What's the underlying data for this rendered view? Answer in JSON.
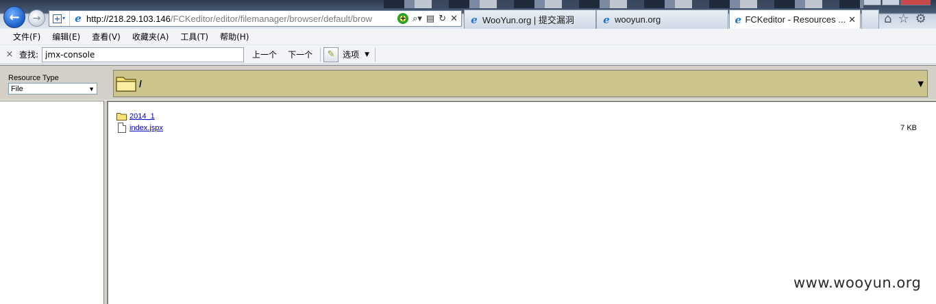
{
  "browser": {
    "url_host": "http://218.29.103.146",
    "url_path": "/FCKeditor/editor/filemanager/browser/default/brow",
    "tabs": [
      {
        "title": "WooYun.org | 提交漏洞",
        "icon": "ie-icon"
      },
      {
        "title": "wooyun.org",
        "icon": "ie-icon"
      },
      {
        "title": "FCKeditor - Resources ...",
        "icon": "ie-icon",
        "active": true
      }
    ]
  },
  "menu": [
    "文件(F)",
    "编辑(E)",
    "查看(V)",
    "收藏夹(A)",
    "工具(T)",
    "帮助(H)"
  ],
  "find": {
    "close": "×",
    "label": "查找:",
    "value": "jmx-console",
    "prev": "上一个",
    "next": "下一个",
    "options": "选项"
  },
  "fck": {
    "resource_type_label": "Resource Type",
    "resource_type_value": "File",
    "current_folder": "/",
    "items": [
      {
        "type": "folder",
        "name": "2014_1",
        "size": ""
      },
      {
        "type": "file",
        "name": "index.jspx",
        "size": "7 KB"
      }
    ]
  },
  "watermark": "www.wooyun.org",
  "colors": {
    "folder_bar": "#cbc58d",
    "link": "#0000cc",
    "panel": "#d4d0c8"
  }
}
